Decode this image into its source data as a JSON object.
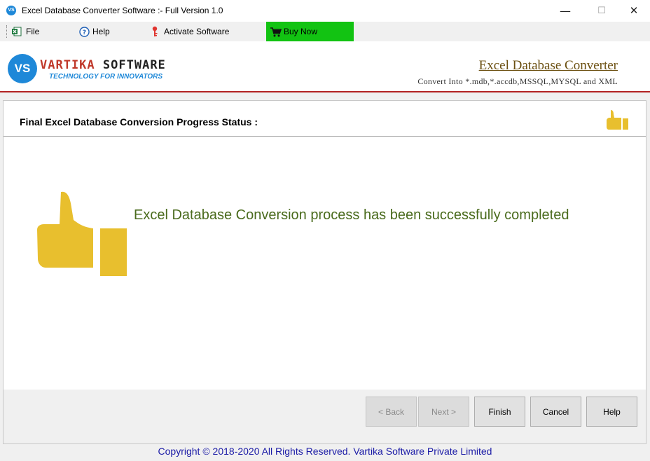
{
  "window": {
    "app_icon_text": "VS",
    "title": "Excel Database Converter Software :- Full Version 1.0",
    "minimize": "—",
    "maximize": "☐",
    "close": "✕"
  },
  "menu": {
    "file": "File",
    "help": "Help",
    "activate": "Activate Software",
    "buy": "Buy Now"
  },
  "header": {
    "logo_text": "VS",
    "brand_part1": "VARTIKA",
    "brand_part2": "SOFTWARE",
    "tagline": "TECHNOLOGY FOR INNOVATORS",
    "product_title": "Excel Database Converter",
    "product_subtitle": "Convert Into *.mdb,*.accdb,MSSQL,MYSQL and XML"
  },
  "status": {
    "heading": "Final Excel Database Conversion Progress Status :",
    "message": "Excel Database Conversion process has been successfully completed"
  },
  "buttons": {
    "back": "< Back",
    "next": "Next >",
    "finish": "Finish",
    "cancel": "Cancel",
    "help": "Help"
  },
  "footer": "Copyright © 2018-2020 All Rights Reserved. Vartika Software Private Limited",
  "icons": [
    "excel-icon",
    "help-icon",
    "key-icon",
    "cart-icon",
    "thumbs-up-icon"
  ],
  "colors": {
    "accent": "#1e88d8",
    "buy_now": "#12c312",
    "thumb": "#e8bf2e",
    "message": "#4a6b1d",
    "header_rule": "#b22222"
  }
}
